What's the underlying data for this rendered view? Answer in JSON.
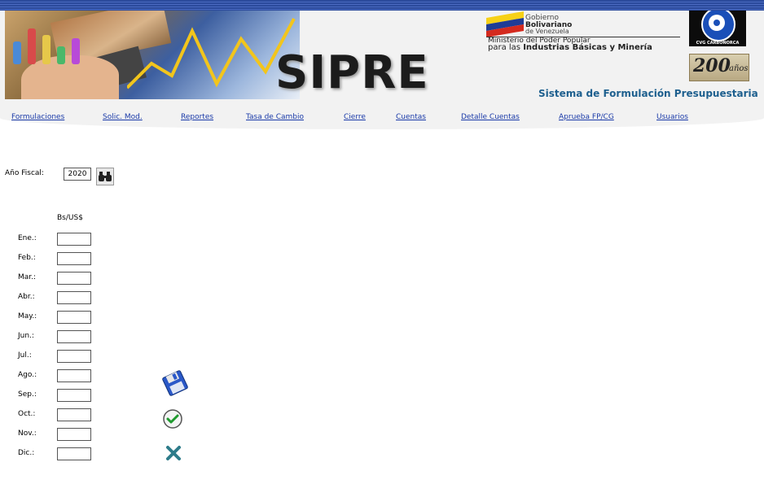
{
  "header": {
    "app_name": "SIPRE",
    "subtitle": "Sistema de Formulación Presupuestaria",
    "gov_line1": "Gobierno",
    "gov_line2": "Bolivariano",
    "gov_line3": "de Venezuela",
    "gov_line4": "Ministerio del Poder Popular",
    "gov_line5_prefix": "para las",
    "gov_line5_bold": "Industrias Básicas y Minería",
    "cvg_text": "CVG CARBONORCA",
    "badge_number": "200",
    "badge_word": "años",
    "flag_colors": [
      "#f7d117",
      "#1f3c96",
      "#d42a1e"
    ]
  },
  "nav": {
    "items": [
      "Formulaciones",
      "Solic. Mod.",
      "Reportes",
      "Tasa de Cambio",
      "Cierre",
      "Cuentas",
      "Detalle Cuentas",
      "Aprueba FP/CG",
      "Usuarios"
    ]
  },
  "form": {
    "fiscal_year_label": "Año Fiscal:",
    "fiscal_year_value": "2020",
    "search_icon": "binoculars-icon",
    "column_header": "Bs/US$",
    "months": [
      "Ene.:",
      "Feb.:",
      "Mar.:",
      "Abr.:",
      "May.:",
      "Jun.:",
      "Jul.:",
      "Ago.:",
      "Sep.:",
      "Oct.:",
      "Nov.:",
      "Dic.:"
    ],
    "rates": [
      "",
      "",
      "",
      "",
      "",
      "",
      "",
      "",
      "",
      "",
      "",
      ""
    ]
  },
  "actions": {
    "save_icon": "floppy-disk-icon",
    "accept_icon": "checkmark-icon",
    "cancel_icon": "x-icon"
  },
  "colors": {
    "link": "#1a3aa8",
    "subtitle": "#1d5f8e",
    "header_bg": "#f2f2f2"
  }
}
